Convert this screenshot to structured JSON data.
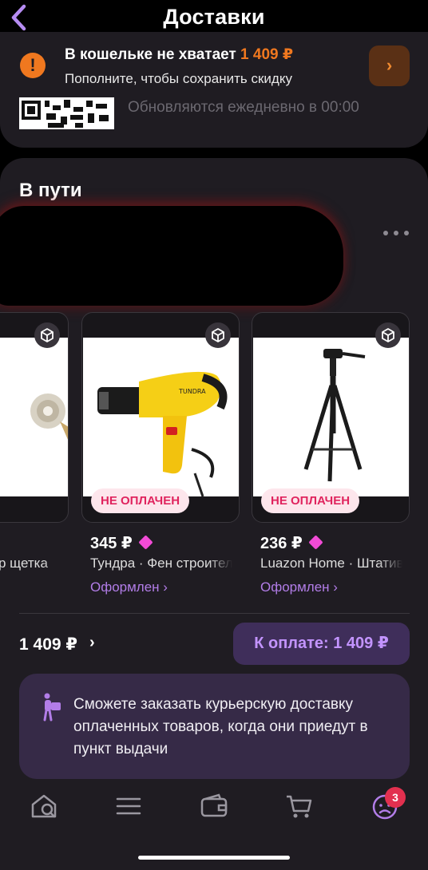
{
  "header": {
    "title": "Доставки",
    "back_icon": "chevron-left-icon"
  },
  "wallet_warning": {
    "title": "В кошельке не хватает ",
    "amount": "1 409 ₽",
    "subtitle": "Пополните, чтобы сохранить скидку",
    "icon": "exclamation-icon"
  },
  "qr_hint": "Обновляются ежедневно в 00:00",
  "section": {
    "title": "В пути"
  },
  "products": [
    {
      "name": "р щетка",
      "status_badge": "",
      "price": "",
      "status": ""
    },
    {
      "price": "345 ₽",
      "name": "Тундра · Фен строительный",
      "status_badge": "НЕ ОПЛАЧЕН",
      "status": "Оформлен ›"
    },
    {
      "price": "236 ₽",
      "name": "Luazon Home · Штатив",
      "status_badge": "НЕ ОПЛАЧЕН",
      "status": "Оформлен ›"
    }
  ],
  "summary": {
    "total": "1 409 ₽",
    "chevron": "›",
    "pay_button": "К оплате: 1 409 ₽"
  },
  "info": {
    "text": "Сможете заказать курьерскую доставку оплаченных товаров, когда они приедут в пункт выдачи"
  },
  "tabbar": {
    "tabs": [
      "search-home-icon",
      "catalog-icon",
      "wallet-icon",
      "cart-icon",
      "profile-icon"
    ],
    "profile_badge": "3"
  },
  "colors": {
    "accent": "#c394ff",
    "warning": "#f0781f",
    "badge_text": "#e0245e",
    "diamond": "#f24bd6"
  }
}
